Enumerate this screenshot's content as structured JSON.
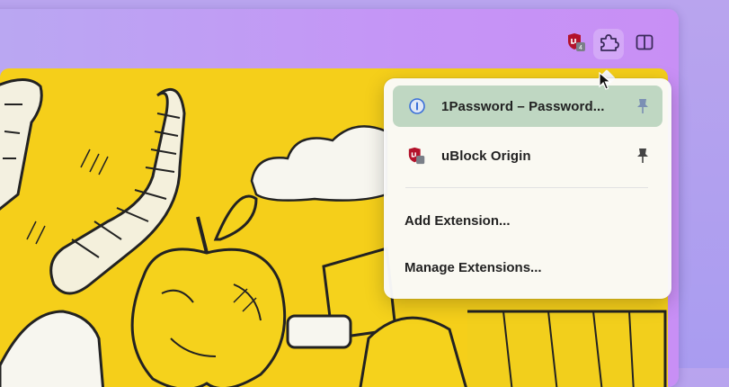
{
  "toolbar": {
    "icons": [
      "ublock-origin-icon",
      "extensions-puzzle-icon",
      "split-view-icon"
    ],
    "ublock_badge": "4"
  },
  "extensions_popup": {
    "items": [
      {
        "label": "1Password – Password...",
        "icon": "1password-icon",
        "pinned": true,
        "highlighted": true
      },
      {
        "label": "uBlock Origin",
        "icon": "ublock-origin-icon",
        "pinned": true,
        "highlighted": false
      }
    ],
    "actions": [
      {
        "label": "Add Extension..."
      },
      {
        "label": "Manage Extensions..."
      }
    ]
  },
  "colors": {
    "highlight": "#bfd7c2",
    "page_background": "#f5cf1a",
    "window_gradient_end": "#c88ff5"
  }
}
